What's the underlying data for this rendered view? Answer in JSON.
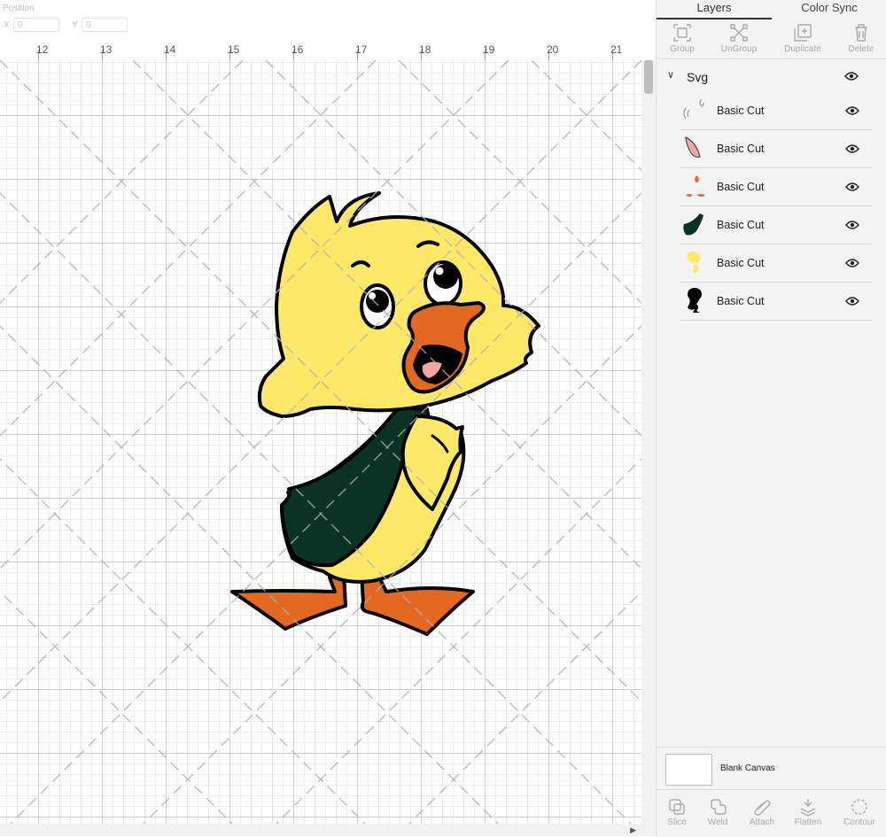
{
  "position_bar": {
    "label": "Position",
    "x_label": "X",
    "x_value": "0",
    "y_label": "Y",
    "y_value": "0"
  },
  "ruler": {
    "labels": [
      "12",
      "13",
      "14",
      "15",
      "16",
      "17",
      "18",
      "19",
      "20",
      "21"
    ]
  },
  "panel": {
    "tabs": {
      "layers": "Layers",
      "color_sync": "Color Sync"
    },
    "tools": {
      "group": "Group",
      "ungroup": "UnGroup",
      "duplicate": "Duplicate",
      "delete": "Delete"
    },
    "group_name": "Svg",
    "layers": [
      {
        "name": "Basic Cut",
        "thumb": "eye-details",
        "color": "#ffffff"
      },
      {
        "name": "Basic Cut",
        "thumb": "tongue",
        "color": "#f4a6a0"
      },
      {
        "name": "Basic Cut",
        "thumb": "orange-parts",
        "color": "#e2691f"
      },
      {
        "name": "Basic Cut",
        "thumb": "green-wing",
        "color": "#0b3325"
      },
      {
        "name": "Basic Cut",
        "thumb": "yellow-body",
        "color": "#fde868"
      },
      {
        "name": "Basic Cut",
        "thumb": "black-outline",
        "color": "#000000"
      }
    ],
    "blank_canvas": "Blank Canvas",
    "bottom_tools": {
      "slice": "Slice",
      "weld": "Weld",
      "attach": "Attach",
      "flatten": "Flatten",
      "contour": "Contour"
    }
  },
  "colors": {
    "duck_yellow": "#fde868",
    "beak_orange": "#e2691f",
    "wing_green": "#0b3325",
    "tongue_pink": "#f4a6a0",
    "outline": "#000000"
  }
}
